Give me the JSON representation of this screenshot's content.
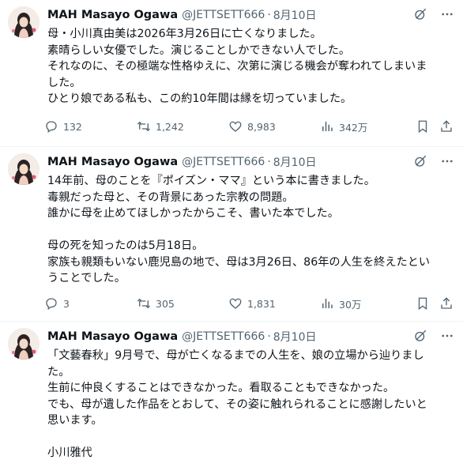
{
  "tweets": [
    {
      "author": {
        "name": "MAH Masayo Ogawa",
        "handle": "@JETTSETT666",
        "separator": "·",
        "date": "8月10日"
      },
      "lines": [
        "母・小川真由美は2026年3月26日に亡くなりました。",
        "素晴らしい女優でした。演じることしかできない人でした。",
        "それなのに、その極端な性格ゆえに、次第に演じる機会が奪われてしまいま",
        "した。",
        "ひとり娘である私も、この約10年間は縁を切っていました。"
      ],
      "stats": {
        "replies": "132",
        "reposts": "1,242",
        "likes": "8,983",
        "views": "342万"
      }
    },
    {
      "author": {
        "name": "MAH Masayo Ogawa",
        "handle": "@JETTSETT666",
        "separator": "·",
        "date": "8月10日"
      },
      "lines": [
        "14年前、母のことを『ポイズン・ママ』という本に書きました。",
        "毒親だった母と、その背景にあった宗教の問題。",
        "誰かに母を止めてほしかったからこそ、書いた本でした。",
        "",
        "母の死を知ったのは5月18日。",
        "家族も親類もいない鹿児島の地で、母は3月26日、86年の人生を終えたとい",
        "うことでした。"
      ],
      "stats": {
        "replies": "3",
        "reposts": "305",
        "likes": "1,831",
        "views": "30万"
      }
    },
    {
      "author": {
        "name": "MAH Masayo Ogawa",
        "handle": "@JETTSETT666",
        "separator": "·",
        "date": "8月10日"
      },
      "lines": [
        "「文藝春秋」9月号で、母が亡くなるまでの人生を、娘の立場から辿りまし",
        "た。",
        "生前に仲良くすることはできなかった。看取ることもできなかった。",
        "でも、母が遺した作品をとおして、その姿に触れられることに感謝したいと",
        "思います。",
        "",
        "小川雅代"
      ]
    }
  ],
  "icons": {
    "grok": "grok-icon",
    "more": "more-icon",
    "reply": "reply-icon",
    "repost": "repost-icon",
    "like": "like-icon",
    "views": "views-icon",
    "bookmark": "bookmark-icon",
    "share": "share-icon"
  },
  "colors": {
    "text": "#0f1419",
    "muted": "#536471",
    "divider": "#eff3f4"
  }
}
